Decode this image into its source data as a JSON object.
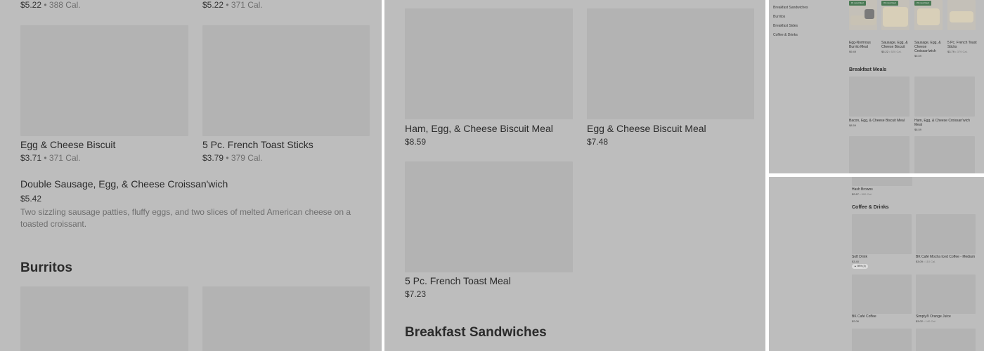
{
  "panel_a": {
    "top_row": [
      {
        "price": "$5.22",
        "cal": "388 Cal."
      },
      {
        "price": "$5.22",
        "cal": "371 Cal."
      }
    ],
    "items": [
      {
        "name": "Egg & Cheese Biscuit",
        "price": "$3.71",
        "cal": "371 Cal."
      },
      {
        "name": "5 Pc. French Toast Sticks",
        "price": "$3.79",
        "cal": "379 Cal."
      }
    ],
    "featured": {
      "name": "Double Sausage, Egg, & Cheese Croissan'wich",
      "price": "$5.42",
      "description": "Two sizzling sausage patties, fluffy eggs, and two slices of melted American cheese on a toasted croissant."
    },
    "section_title": "Burritos",
    "dot": "•"
  },
  "panel_b": {
    "items": [
      {
        "name": "Ham, Egg, & Cheese Biscuit Meal",
        "price": "$8.59"
      },
      {
        "name": "Egg & Cheese Biscuit Meal",
        "price": "$7.48"
      },
      {
        "name": "5 Pc. French Toast Meal",
        "price": "$7.23"
      }
    ],
    "section_title": "Breakfast Sandwiches"
  },
  "panel_c": {
    "sidebar": [
      "Breakfast Sandwiches",
      "Burritos",
      "Breakfast Sides",
      "Coffee & Drinks"
    ],
    "badges": [
      "#1 most liked",
      "#2 most liked",
      "#3 most liked"
    ],
    "carousel": [
      {
        "name": "Egg-Normous Burrito Meal",
        "price": "$9.49"
      },
      {
        "name": "Sausage, Egg, & Cheese Biscuit",
        "price": "$5.22",
        "cal": "520 Cal."
      },
      {
        "name": "Sausage, Egg, & Cheese Croissan'wich",
        "price": "$5.59"
      },
      {
        "name": "5 Pc. French Toast Sticks",
        "price": "$3.79",
        "cal": "379 Cal."
      }
    ],
    "section_title": "Breakfast Meals",
    "meals": [
      {
        "name": "Bacon, Egg, & Cheese Biscuit Meal",
        "price": "$8.59"
      },
      {
        "name": "Ham, Egg, & Cheese Croissan'wich Meal",
        "price": "$8.59"
      }
    ]
  },
  "panel_d": {
    "top_item": {
      "name": "Hash Browns",
      "price": "$2.67",
      "cal": "500 Cal."
    },
    "section_title": "Coffee & Drinks",
    "items": [
      {
        "name": "Soft Drink",
        "price": "$3.40",
        "rating": "98% (4)"
      },
      {
        "name": "BK Café Mocha Iced Coffee - Medium",
        "price": "$3.09",
        "cal": "110 Cal."
      },
      {
        "name": "BK Café Coffee",
        "price": "$2.06"
      },
      {
        "name": "Simply® Orange Juice",
        "price": "$3.02",
        "cal": "140 Cal."
      }
    ]
  }
}
